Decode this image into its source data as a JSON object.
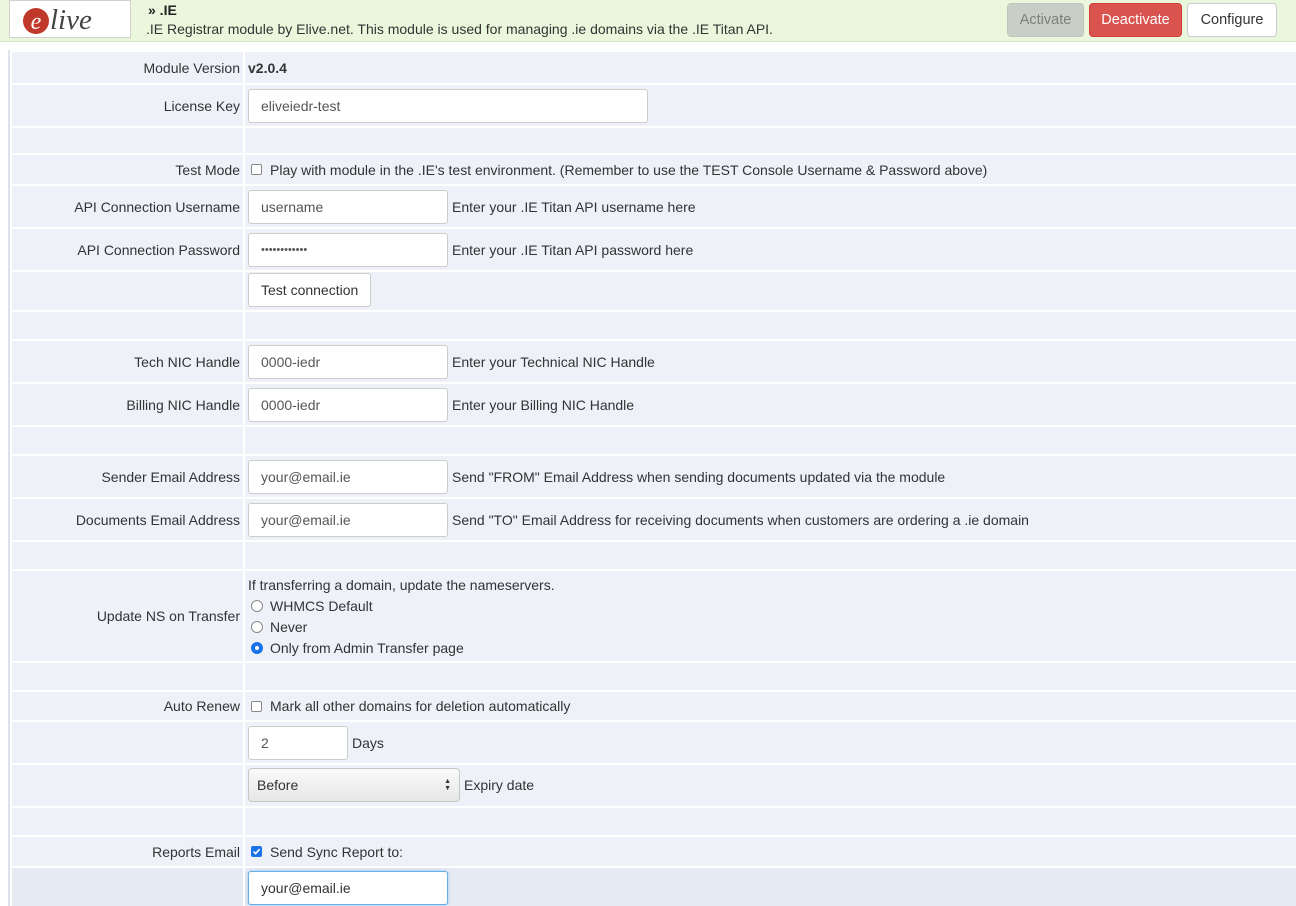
{
  "header": {
    "title": "» .IE",
    "description": ".IE Registrar module by Elive.net. This module is used for managing .ie domains via the .IE Titan API.",
    "logo_text": "elive",
    "buttons": {
      "activate": "Activate",
      "deactivate": "Deactivate",
      "configure": "Configure"
    },
    "colors": {
      "header_bg": "#eaf7dd",
      "deactivate": "#d9534f",
      "logo": "#c0392b"
    }
  },
  "form": {
    "module_version": {
      "label": "Module Version",
      "value": "v2.0.4"
    },
    "license_key": {
      "label": "License Key",
      "value": "eliveiedr-test"
    },
    "test_mode": {
      "label": "Test Mode",
      "checked": false,
      "text": "Play with module in the .IE's test environment. (Remember to use the TEST Console Username & Password above)"
    },
    "api_username": {
      "label": "API Connection Username",
      "value": "username",
      "help": "Enter your .IE Titan API username here"
    },
    "api_password": {
      "label": "API Connection Password",
      "value": "••••••••••••",
      "help": "Enter your .IE Titan API password here"
    },
    "test_connection": {
      "label": "Test connection"
    },
    "tech_nic": {
      "label": "Tech NIC Handle",
      "value": "0000-iedr",
      "help": "Enter your Technical NIC Handle"
    },
    "billing_nic": {
      "label": "Billing NIC Handle",
      "value": "0000-iedr",
      "help": "Enter your Billing NIC Handle"
    },
    "sender_email": {
      "label": "Sender Email Address",
      "value": "your@email.ie",
      "help": "Send \"FROM\" Email Address when sending documents updated via the module"
    },
    "documents_email": {
      "label": "Documents Email Address",
      "value": "your@email.ie",
      "help": "Send \"TO\" Email Address for receiving documents when customers are ordering a .ie domain"
    },
    "update_ns": {
      "label": "Update NS on Transfer",
      "intro": "If transferring a domain, update the nameservers.",
      "options": [
        "WHMCS Default",
        "Never",
        "Only from Admin Transfer page"
      ],
      "selected": "Only from Admin Transfer page"
    },
    "auto_renew": {
      "label": "Auto Renew",
      "checked": false,
      "text": "Mark all other domains for deletion automatically"
    },
    "days": {
      "value": "2",
      "unit": "Days"
    },
    "timing": {
      "selected": "Before",
      "suffix": "Expiry date"
    },
    "reports_email": {
      "label": "Reports Email",
      "checked": true,
      "text": "Send Sync Report to:",
      "value": "your@email.ie"
    }
  }
}
